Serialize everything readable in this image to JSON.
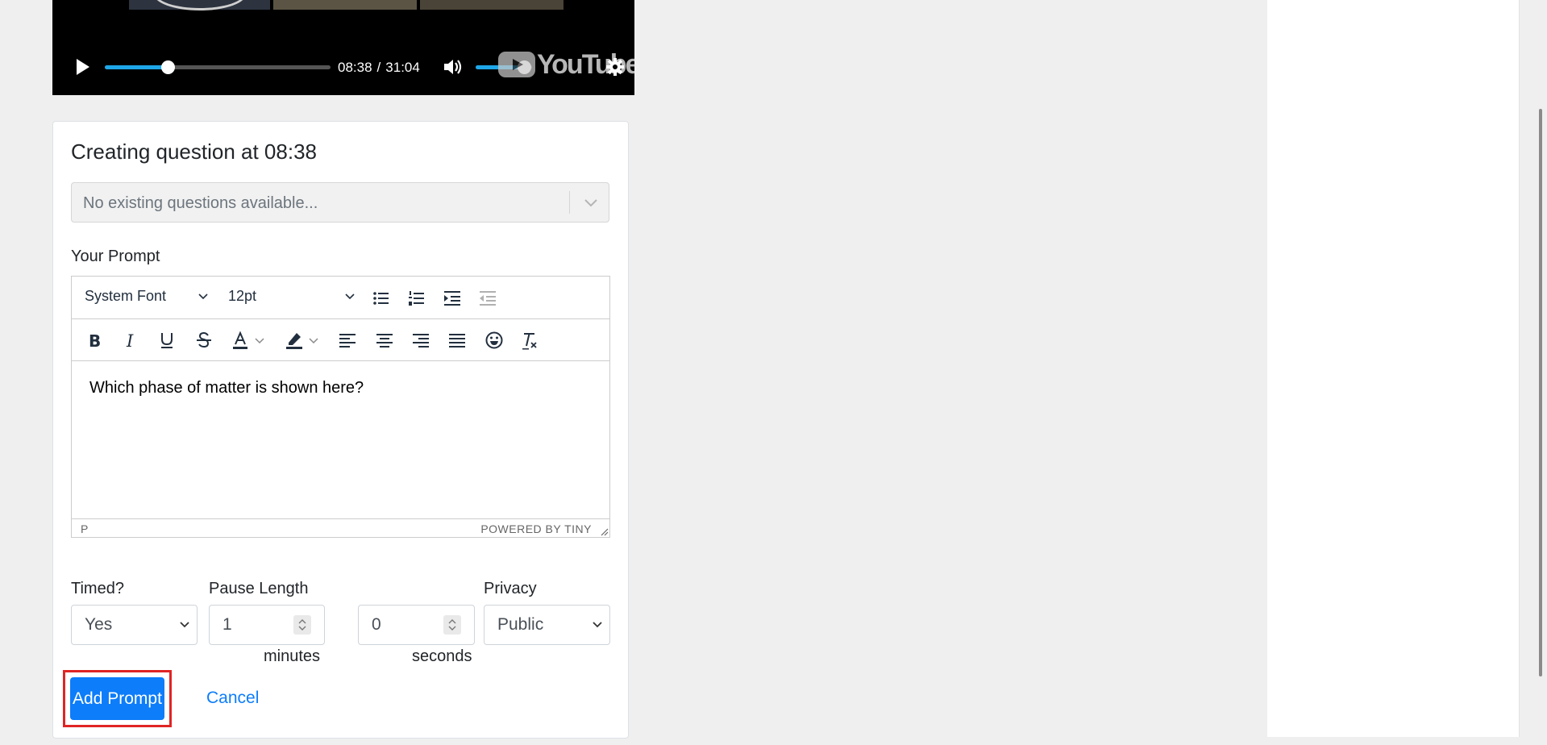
{
  "player": {
    "current_time": "08:38",
    "separator": "/",
    "duration": "31:04",
    "progress_fraction": 0.28,
    "volume_fraction": 0.85,
    "logo_text": "YouTube"
  },
  "card": {
    "title": "Creating question at 08:38",
    "existing_placeholder": "No existing questions available...",
    "prompt_label": "Your Prompt"
  },
  "editor": {
    "font_family": "System Font",
    "font_size": "12pt",
    "content": "Which phase of matter is shown here?",
    "status_path": "P",
    "status_brand": "POWERED BY TINY"
  },
  "form": {
    "timed_label": "Timed?",
    "timed_value": "Yes",
    "pause_label": "Pause Length",
    "minutes_value": "1",
    "minutes_unit": "minutes",
    "seconds_value": "0",
    "seconds_unit": "seconds",
    "privacy_label": "Privacy",
    "privacy_value": "Public"
  },
  "actions": {
    "add_label": "Add Prompt",
    "cancel_label": "Cancel"
  },
  "colors": {
    "primary": "#0d7dfa",
    "highlight": "#e02424",
    "progress": "#1ea7e8"
  }
}
